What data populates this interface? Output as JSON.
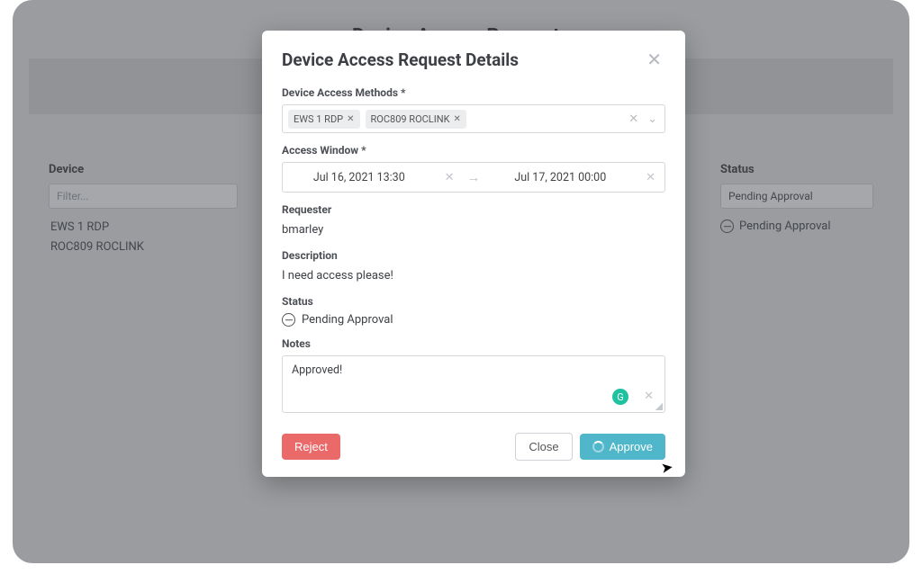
{
  "background": {
    "page_title": "Device Access Requests",
    "columns": {
      "device_header": "Device",
      "status_header": "Status",
      "filter_placeholder": "Filter...",
      "device_rows": [
        "EWS 1 RDP",
        "ROC809 ROCLINK"
      ],
      "status_filter_value": "Pending Approval",
      "status_row_value": "Pending Approval"
    }
  },
  "modal": {
    "title": "Device Access Request Details",
    "labels": {
      "methods": "Device Access Methods *",
      "window": "Access Window *",
      "requester": "Requester",
      "description": "Description",
      "status": "Status",
      "notes": "Notes"
    },
    "methods": {
      "chips": [
        "EWS 1 RDP",
        "ROC809 ROCLINK"
      ]
    },
    "window": {
      "start": "Jul 16, 2021 13:30",
      "end": "Jul 17, 2021 00:00"
    },
    "requester_value": "bmarley",
    "description_value": "I need access please!",
    "status_value": "Pending Approval",
    "notes_value": "Approved!",
    "buttons": {
      "reject": "Reject",
      "close": "Close",
      "approve": "Approve"
    }
  }
}
